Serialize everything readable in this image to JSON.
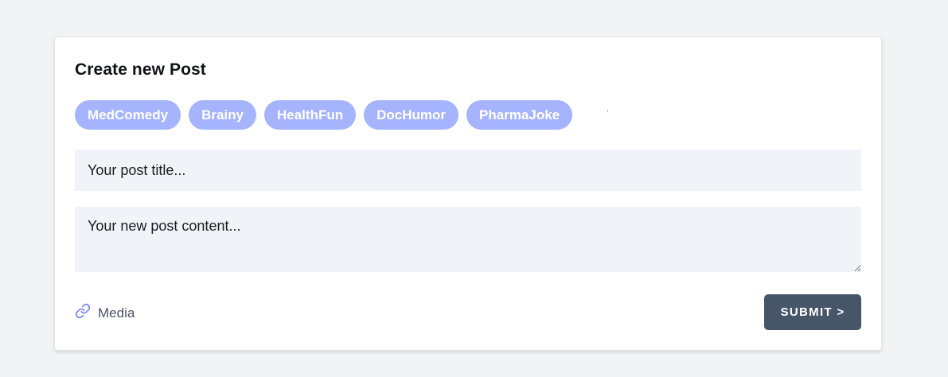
{
  "card": {
    "title": "Create new Post",
    "tags": [
      "MedComedy",
      "Brainy",
      "HealthFun",
      "DocHumor",
      "PharmaJoke"
    ],
    "title_placeholder": "Your post title...",
    "content_placeholder": "Your new post content...",
    "media_label": "Media",
    "media_icon": "link-icon",
    "submit_label": "SUBMIT >"
  },
  "colors": {
    "page_background": "#f2f3f5",
    "card_background": "#ffffff",
    "tag_background": "#a5b4fc",
    "input_background": "#f0f3f8",
    "submit_background": "#475569",
    "icon_color": "#818cf8"
  }
}
